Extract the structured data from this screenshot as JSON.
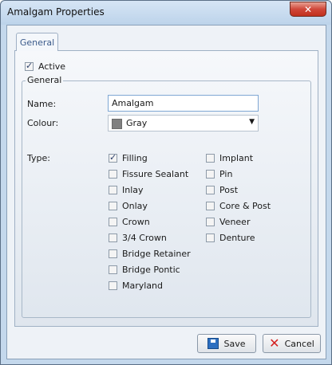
{
  "window": {
    "title": "Amalgam Properties",
    "close_glyph": "✕"
  },
  "tab": {
    "label": "General"
  },
  "active": {
    "label": "Active",
    "checked": true
  },
  "group": {
    "title": "General",
    "name_label": "Name:",
    "name_value": "Amalgam",
    "colour_label": "Colour:",
    "colour_value": "Gray",
    "colour_hex": "#808080",
    "type_label": "Type:"
  },
  "types_col1": [
    {
      "label": "Filling",
      "checked": true
    },
    {
      "label": "Fissure Sealant",
      "checked": false
    },
    {
      "label": "Inlay",
      "checked": false
    },
    {
      "label": "Onlay",
      "checked": false
    },
    {
      "label": "Crown",
      "checked": false
    },
    {
      "label": "3/4 Crown",
      "checked": false
    },
    {
      "label": "Bridge Retainer",
      "checked": false
    },
    {
      "label": "Bridge Pontic",
      "checked": false
    },
    {
      "label": "Maryland",
      "checked": false
    }
  ],
  "types_col2": [
    {
      "label": "Implant",
      "checked": false
    },
    {
      "label": "Pin",
      "checked": false
    },
    {
      "label": "Post",
      "checked": false
    },
    {
      "label": "Core & Post",
      "checked": false
    },
    {
      "label": "Veneer",
      "checked": false
    },
    {
      "label": "Denture",
      "checked": false
    }
  ],
  "buttons": {
    "save": "Save",
    "cancel": "Cancel"
  },
  "icons": {
    "save": "floppy-disk-icon",
    "cancel": "red-x-icon"
  }
}
